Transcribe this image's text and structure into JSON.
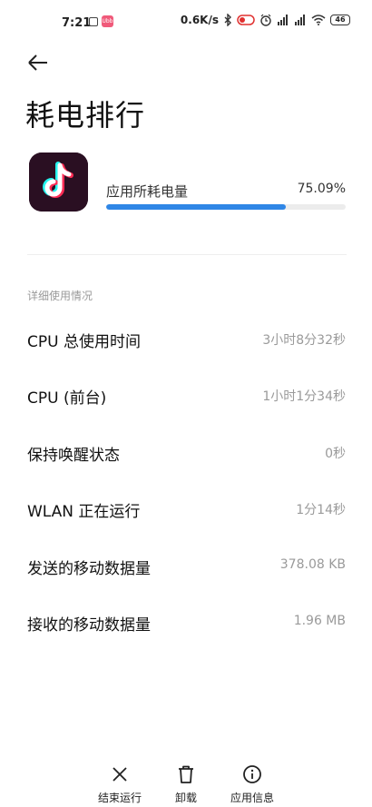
{
  "status_bar": {
    "time": "7:21",
    "app_badge_text": "Ubb",
    "net_speed": "0.6K/s",
    "battery": "46"
  },
  "page": {
    "title": "耗电排行"
  },
  "app_usage": {
    "label": "应用所耗电量",
    "percent_text": "75.09%",
    "fraction": 0.7509,
    "accent_color": "#2f86e6"
  },
  "details": {
    "section_label": "详细使用情况",
    "rows": [
      {
        "label": "CPU 总使用时间",
        "value": "3小时8分32秒"
      },
      {
        "label": "CPU (前台)",
        "value": "1小时1分34秒"
      },
      {
        "label": "保持唤醒状态",
        "value": "0秒"
      },
      {
        "label": "WLAN 正在运行",
        "value": "1分14秒"
      },
      {
        "label": "发送的移动数据量",
        "value": "378.08 KB"
      },
      {
        "label": "接收的移动数据量",
        "value": "1.96 MB"
      }
    ]
  },
  "actions": {
    "force_stop": "结束运行",
    "uninstall": "卸载",
    "app_info": "应用信息"
  },
  "icons": {
    "back": "arrow-left-icon",
    "app": "tiktok-icon",
    "force_stop": "close-icon",
    "uninstall": "trash-icon",
    "app_info": "info-icon"
  }
}
